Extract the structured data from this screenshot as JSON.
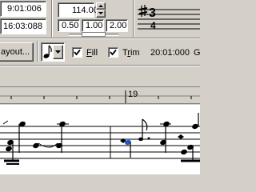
{
  "top": {
    "time_position": "9:01:006",
    "time_total": "16:03:088",
    "tempo": "114.00",
    "speed_values": [
      "0.50",
      "1.00",
      "2.00"
    ],
    "time_sig_top": "3",
    "time_sig_bottom": "4"
  },
  "toolbar": {
    "layout_button": "ayout...",
    "fill_label": "Fill",
    "trim_label": "Trim",
    "time_readout": "20:01:000",
    "trailing_char": "G"
  },
  "ruler": {
    "measure_label": "19"
  },
  "colors": {
    "face": "#d4d0c8",
    "accent_note": "#1a5fc0"
  }
}
